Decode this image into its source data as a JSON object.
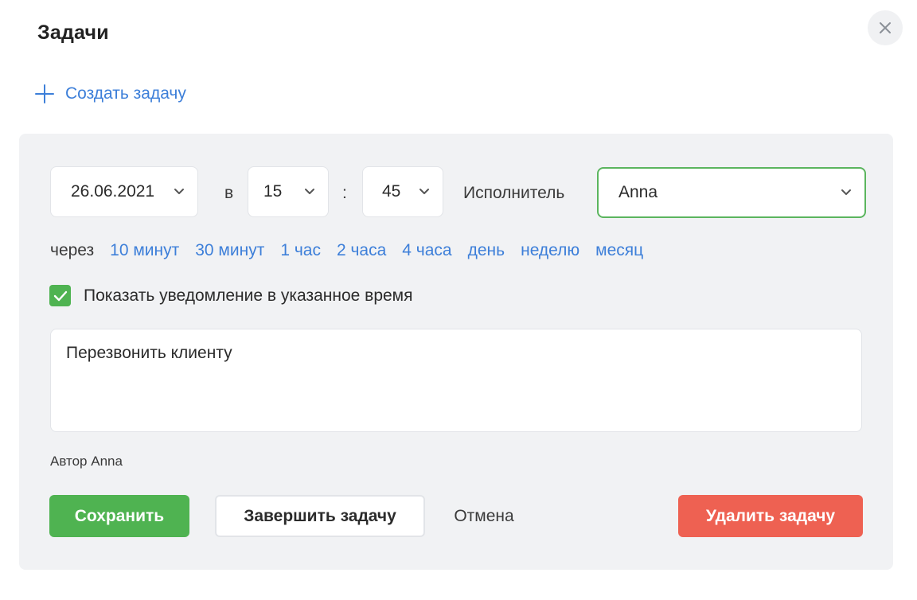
{
  "dialog": {
    "title": "Задачи"
  },
  "create": {
    "label": "Создать задачу"
  },
  "form": {
    "date_value": "26.06.2021",
    "at_label": "в",
    "hour_value": "15",
    "time_separator": ":",
    "minute_value": "45",
    "assignee_label": "Исполнитель",
    "assignee_value": "Anna",
    "quick_label": "через",
    "quick_options": [
      "10 минут",
      "30 минут",
      "1 час",
      "2 часа",
      "4 часа",
      "день",
      "неделю",
      "месяц"
    ],
    "notify_checked": true,
    "notify_label": "Показать уведомление в указанное время",
    "task_text": "Перезвонить клиенту",
    "author_text": "Автор Anna"
  },
  "actions": {
    "save_label": "Сохранить",
    "finish_label": "Завершить задачу",
    "cancel_label": "Отмена",
    "delete_label": "Удалить задачу"
  },
  "colors": {
    "accent_blue": "#3d7fd9",
    "green": "#4fb351",
    "red": "#ee6152",
    "panel_bg": "#f1f2f4"
  },
  "icons": [
    "close-icon",
    "plus-icon",
    "chevron-down-icon",
    "checkmark-icon"
  ]
}
